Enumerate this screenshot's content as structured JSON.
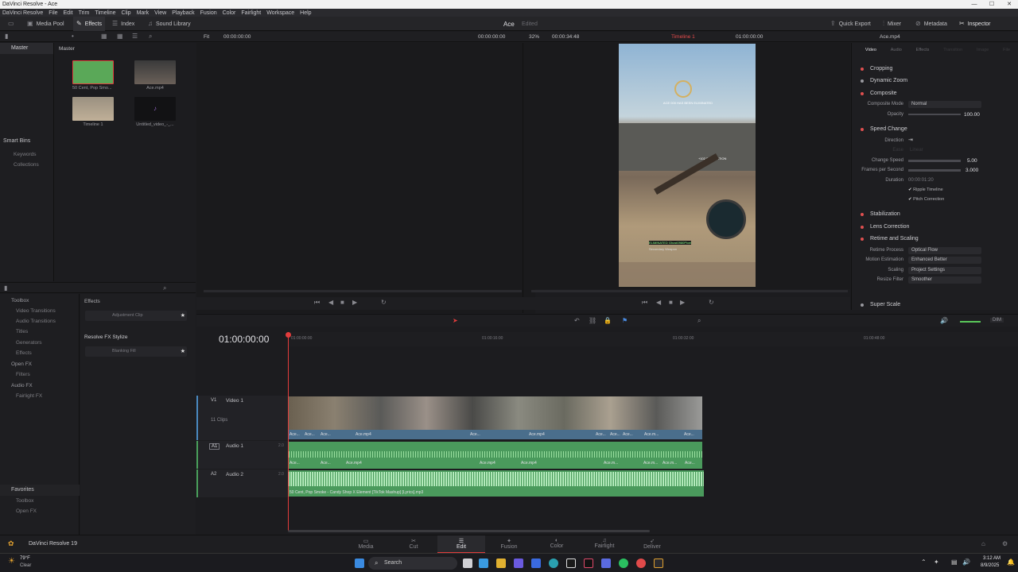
{
  "window": {
    "title": "DaVinci Resolve - Ace",
    "min": "—",
    "max": "☐",
    "close": "✕"
  },
  "menu": [
    "DaVinci Resolve",
    "File",
    "Edit",
    "Trim",
    "Timeline",
    "Clip",
    "Mark",
    "View",
    "Playback",
    "Fusion",
    "Color",
    "Fairlight",
    "Workspace",
    "Help"
  ],
  "toolbar": {
    "media_pool": "Media Pool",
    "effects": "Effects",
    "index": "Index",
    "sound_library": "Sound Library",
    "project_name": "Ace",
    "edited": "Edited",
    "quick_export": "Quick Export",
    "mixer": "Mixer",
    "metadata": "Metadata",
    "inspector": "Inspector"
  },
  "viewer_bar": {
    "fit": "Fit",
    "src_tc": "00:00:00:00",
    "src_tc2": "00:00:00:00",
    "zoom": "32%",
    "duration": "00:00:34:48",
    "timeline_name": "Timeline 1",
    "tl_tc": "01:00:00:00",
    "clip_name": "Ace.mp4"
  },
  "media_pool": {
    "master": "Master",
    "bin_title": "Master",
    "clips": [
      {
        "name": "50 Cent, Pop Smo..."
      },
      {
        "name": "Ace.mp4"
      },
      {
        "name": "Timeline 1"
      },
      {
        "name": "Untitled_video_-_..."
      }
    ],
    "smart_bins": "Smart Bins",
    "keywords": "Keywords",
    "collections": "Collections"
  },
  "effects_panel": {
    "tree": [
      {
        "label": "Toolbox",
        "level": 0
      },
      {
        "label": "Video Transitions",
        "level": 1
      },
      {
        "label": "Audio Transitions",
        "level": 1
      },
      {
        "label": "Titles",
        "level": 1
      },
      {
        "label": "Generators",
        "level": 1
      },
      {
        "label": "Effects",
        "level": 1
      },
      {
        "label": "Open FX",
        "level": 0
      },
      {
        "label": "Filters",
        "level": 1
      },
      {
        "label": "Audio FX",
        "level": 0
      },
      {
        "label": "Fairlight FX",
        "level": 1
      }
    ],
    "favorites": "Favorites",
    "fav_items": [
      "Toolbox",
      "Open FX"
    ],
    "section1": "Effects",
    "item1": "Adjustment Clip",
    "section2": "Resolve FX Stylize",
    "item2": "Blanking Fill"
  },
  "inspector": {
    "tabs": [
      "Video",
      "Audio",
      "Effects",
      "Transition",
      "Image",
      "File"
    ],
    "cropping": "Cropping",
    "dynamic_zoom": "Dynamic Zoom",
    "composite": "Composite",
    "composite_mode_label": "Composite Mode",
    "composite_mode": "Normal",
    "opacity_label": "Opacity",
    "opacity": "100.00",
    "speed_change": "Speed Change",
    "direction": "Direction",
    "ease": "Ease",
    "ease_val": "Linear",
    "change_speed_label": "Change Speed",
    "change_speed": "5.00",
    "fps_label": "Frames per Second",
    "fps": "3.000",
    "duration_label": "Duration",
    "duration": "00:00:01:20",
    "ripple": "Ripple Timeline",
    "pitch": "Pitch Correction",
    "stabilization": "Stabilization",
    "lens_correction": "Lens Correction",
    "retime_scaling": "Retime and Scaling",
    "retime_process_label": "Retime Process",
    "retime_process": "Optical Flow",
    "motion_est_label": "Motion Estimation",
    "motion_est": "Enhanced Better",
    "scaling_label": "Scaling",
    "scaling": "Project Settings",
    "resize_label": "Resize Filter",
    "resize": "Smoother",
    "super_scale": "Super Scale"
  },
  "viewer": {
    "hud_text": "ACE 000 HAS BEEN ELIMINATED",
    "hud_xp": "+102 ELIMINATION",
    "hud_kill": "ELIMINATED Ghost0980Pixel",
    "hud_sub": "Secondary Weapon"
  },
  "timeline": {
    "timecode": "01:00:00:00",
    "ruler": [
      "01:00:00:00",
      "01:00:16:00",
      "01:00:32:00",
      "01:00:48:00"
    ],
    "v1": {
      "id": "V1",
      "name": "Video 1",
      "clips_count": "11 Clips"
    },
    "a1": {
      "id": "A1",
      "name": "Audio 1",
      "ch": "2.0"
    },
    "a2": {
      "id": "A2",
      "name": "Audio 2",
      "ch": "2.0"
    },
    "video_clip_labels": [
      "Ace...",
      "Ace...",
      "Ace...",
      "Ace.mp4",
      "Ace...",
      "Ace.mp4",
      "Ace...",
      "Ace...",
      "Ace...",
      "Ace.m...",
      "Ace..."
    ],
    "audio1_labels": [
      "Ace...",
      "Ace...",
      "Ace.mp4",
      "Ace.mp4",
      "Ace.mp4",
      "Ace.m...",
      "Ace.m...",
      "Ace.m...",
      "Ace..."
    ],
    "audio2_label": "50 Cent, Pop Smoke - Candy Shop X Element [TikTok Mashup] [Lyrics].mp3",
    "dim": "DIM"
  },
  "pages": [
    "Media",
    "Cut",
    "Edit",
    "Fusion",
    "Color",
    "Fairlight",
    "Deliver"
  ],
  "brand": "DaVinci Resolve 19",
  "taskbar": {
    "weather_temp": "79°F",
    "weather_cond": "Clear",
    "search": "Search",
    "time": "3:12 AM",
    "date": "8/9/2025"
  },
  "colors": {
    "accent": "#e64b4b",
    "playhead": "#e23c3c",
    "video_clip": "#4a6e8c",
    "audio_clip": "#4a9a5c"
  }
}
